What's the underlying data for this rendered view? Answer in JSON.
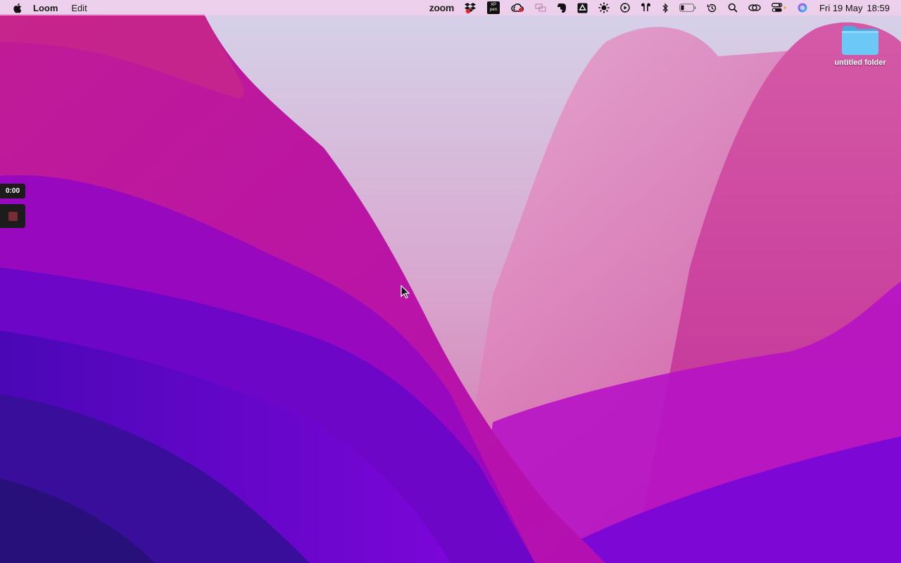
{
  "menubar": {
    "app_name": "Loom",
    "menus": [
      "Edit"
    ],
    "status_icons": [
      "zoom-icon",
      "dropbox-icon",
      "xppen-icon",
      "creative-cloud-icon",
      "screen-mirror-icon",
      "evernote-icon",
      "google-drive-icon",
      "brightness-icon",
      "play-icon",
      "airpods-icon",
      "bluetooth-icon",
      "battery-icon",
      "time-machine-icon",
      "spotlight-icon",
      "screen-share-icon",
      "control-center-icon",
      "siri-icon"
    ],
    "zoom_label": "zoom",
    "xppen_top": "XP",
    "xppen_bottom": "pen",
    "date": "Fri 19 May",
    "time": "18:59"
  },
  "desktop": {
    "folder_label": "untitled folder"
  },
  "loom": {
    "timer": "0:00"
  },
  "colors": {
    "menubar_bg": "#f6ceec",
    "loom_bg": "#1c1c1c",
    "loom_stop": "#7a2c34",
    "folder_blue": "#5fc3f2"
  }
}
